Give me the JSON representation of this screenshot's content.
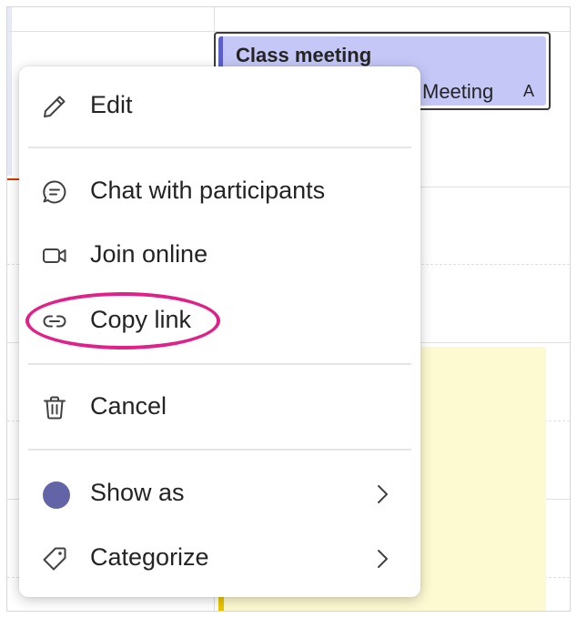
{
  "calendar": {
    "event": {
      "title": "Class meeting",
      "subtitle": "Meeting",
      "badge": "A"
    }
  },
  "menu": {
    "items": [
      {
        "id": "edit",
        "label": "Edit",
        "icon": "pencil-icon"
      },
      {
        "id": "chat",
        "label": "Chat with participants",
        "icon": "chat-icon"
      },
      {
        "id": "join",
        "label": "Join online",
        "icon": "video-camera-icon"
      },
      {
        "id": "copy-link",
        "label": "Copy link",
        "icon": "link-icon"
      },
      {
        "id": "cancel",
        "label": "Cancel",
        "icon": "trash-icon"
      },
      {
        "id": "show-as",
        "label": "Show as",
        "icon": "status-dot-icon",
        "submenu": true
      },
      {
        "id": "categorize",
        "label": "Categorize",
        "icon": "tag-icon",
        "submenu": true
      }
    ]
  },
  "colors": {
    "event_fill": "#c5c7f6",
    "event_accent": "#5b5fc7",
    "show_as_dot": "#6264a7",
    "highlight": "#e0218a",
    "yellow_event": "#fdf9d1"
  }
}
